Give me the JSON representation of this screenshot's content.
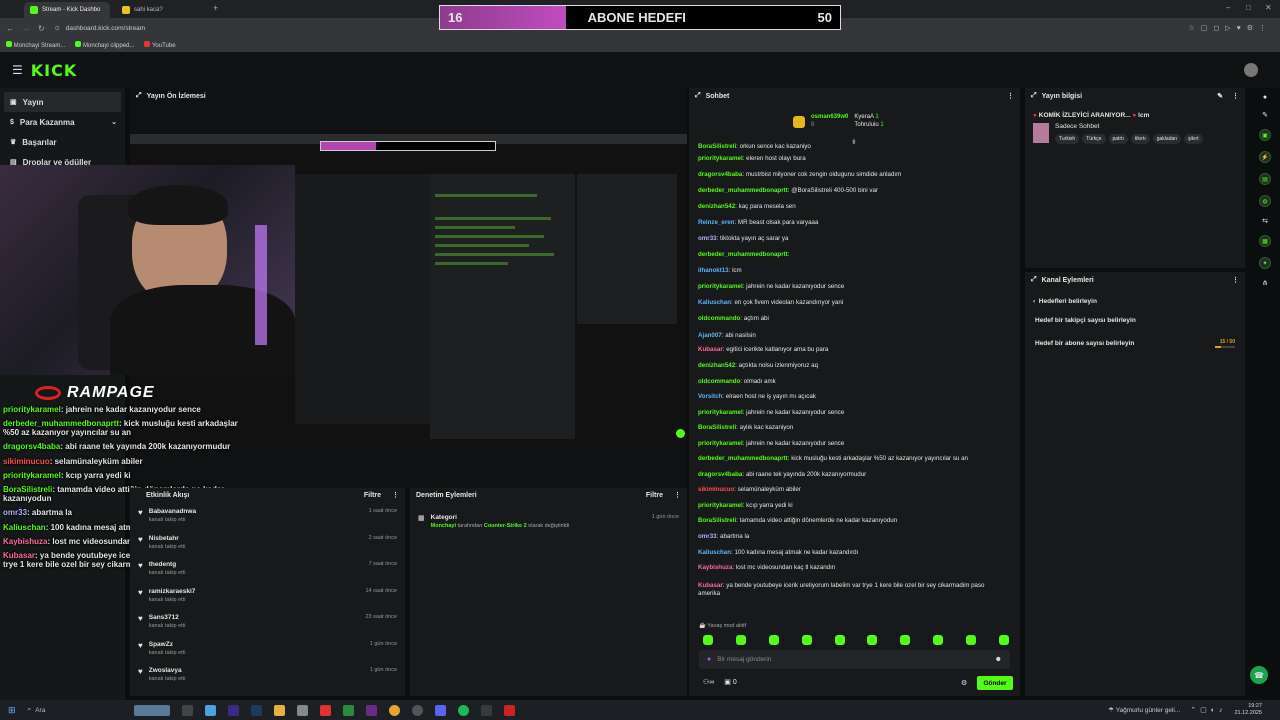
{
  "browser": {
    "tabs": [
      {
        "label": "Stream - Kick Dashbo",
        "active": true
      },
      {
        "label": "sahi kaca?",
        "active": false
      }
    ],
    "url": "dashboard.kick.com/stream",
    "bookmarks": [
      "Monchayi Stream...",
      "Monchayi clipped...",
      "YouTube"
    ]
  },
  "goal_overlay": {
    "current": "16",
    "label": "ABONE HEDEFI",
    "target": "50",
    "progress": 0.32
  },
  "app": {
    "logo": "KICK"
  },
  "sidebar": {
    "items": [
      {
        "label": "Yayın",
        "icon": "broadcast-icon"
      },
      {
        "label": "Para Kazanma",
        "icon": "money-icon"
      },
      {
        "label": "Başarılar",
        "icon": "trophy-icon"
      },
      {
        "label": "Droplar ve ödüller",
        "icon": "gift-icon"
      }
    ]
  },
  "preview": {
    "title": "Yayın Ön İzlemesi"
  },
  "overlay_chat": {
    "brand": "RAMPAGE",
    "lines": [
      {
        "user": "prioritykaramel",
        "color": "#53fc18",
        "text": "jahrein ne kadar kazanıyodur sence"
      },
      {
        "user": "derbeder_muhammedbonaprtt",
        "color": "#53fc18",
        "text": "kick musluğu kesti arkadaşlar %50 az kazanıyor yayıncılar su an"
      },
      {
        "user": "dragorsv4baba",
        "color": "#53fc18",
        "text": "abi raane tek yayında 200k kazanıyormudur"
      },
      {
        "user": "sikiminucuo",
        "color": "#ff4d4d",
        "text": "selamünaleyküm abiler"
      },
      {
        "user": "prioritykaramel",
        "color": "#53fc18",
        "text": "kcıp yarra yedi ki"
      },
      {
        "user": "BoraSilistreli",
        "color": "#53fc18",
        "text": "tamamda video attiğin dönemlerde ne kadar kazanıyodun"
      },
      {
        "user": "omr33",
        "color": "#b0b0ff",
        "text": "abartma la"
      },
      {
        "user": "Kaliuschan",
        "color": "#53fc18",
        "text": "100 kadına mesaj atmak ne kadar kazandırdı"
      },
      {
        "user": "Kaybishuza",
        "color": "#ff6b9d",
        "text": "lost mc videosundan kaç tl kazandın"
      },
      {
        "user": "Kubasar",
        "color": "#ff6b9d",
        "text": "ya bende youtubeye icerik uretiyorum labelim var trye 1 kere bile ozel bir sey cikarmadim paso amerika"
      }
    ]
  },
  "activity": {
    "title": "Etkinlik Akışı",
    "filter_label": "Filtre",
    "items": [
      {
        "name": "Babavanadnwa",
        "sub": "kanalı takip etti",
        "time": "1 saat önce"
      },
      {
        "name": "Nisbetahr",
        "sub": "kanalı takip etti",
        "time": "2 saat önce"
      },
      {
        "name": "thedentg",
        "sub": "kanalı takip etti",
        "time": "7 saat önce"
      },
      {
        "name": "ramizkaraeski7",
        "sub": "kanalı takip etti",
        "time": "14 saat önce"
      },
      {
        "name": "Sans3712",
        "sub": "kanalı takip etti",
        "time": "23 saat önce"
      },
      {
        "name": "SpawZz",
        "sub": "kanalı takip etti",
        "time": "1 gün önce"
      },
      {
        "name": "Zwoslavya",
        "sub": "kanalı takip etti",
        "time": "1 gün önce"
      }
    ]
  },
  "audit": {
    "title": "Denetim Eylemleri",
    "filter_label": "Filtre",
    "item": {
      "title": "Kategori",
      "actor": "Monchayi",
      "middle": "tarafından",
      "category": "Counter-Strike 2",
      "rest": "olarak değiştirildi",
      "time": "1 gün önce"
    }
  },
  "chat": {
    "title": "Sohbet",
    "pinned": {
      "user1": "osman639w0",
      "user1_count": "8",
      "user2": "KyeraA",
      "user2_count": "1",
      "user3": "Tohruluiu",
      "user3_count": "1"
    },
    "messages": [
      {
        "user": "BoraSilistreli",
        "color": "#53fc18",
        "text": "orkun sence kac kazaniyo"
      },
      {
        "user": "prioritykaramel",
        "color": "#53fc18",
        "text": "eleren host olayı bura"
      },
      {
        "user": "dragorsv4baba",
        "color": "#53fc18",
        "text": "mustrbist milyoner cok zengin oldugunu simdide anladım"
      },
      {
        "user": "derbeder_muhammedbonaprtt",
        "color": "#53fc18",
        "text": "@BoraSilistreli 400-500 bini var"
      },
      {
        "user": "denizhan542",
        "color": "#53fc18",
        "text": "kaç para mesela sen"
      },
      {
        "user": "Reinze_eren",
        "color": "#58b8ff",
        "text": "MR beast olsak para varyaaa"
      },
      {
        "user": "omr33",
        "color": "#b0b0ff",
        "text": "tiktokta yayın aç sarar ya"
      },
      {
        "user": "derbeder_muhammedbonaprtt",
        "color": "#53fc18",
        "text": ""
      },
      {
        "user": "ilhanokt13",
        "color": "#58b8ff",
        "text": "lcm"
      },
      {
        "user": "prioritykaramel",
        "color": "#53fc18",
        "text": "jahrein ne kadar kazanıyodur sence"
      },
      {
        "user": "Kaliuschan",
        "color": "#58b8ff",
        "text": "en çok fivem videoları kazandırıyor yani"
      },
      {
        "user": "oldcommando",
        "color": "#53fc18",
        "text": "açtım abi"
      },
      {
        "user": "Ajan007",
        "color": "#58b8ff",
        "text": "abi nasilsin"
      },
      {
        "user": "Kubasar",
        "color": "#ff6b9d",
        "text": "egitici icerikte katlanıyor ama bu para"
      },
      {
        "user": "denizhan542",
        "color": "#53fc18",
        "text": "açtıkta nolsu izlenmiyoruz aq"
      },
      {
        "user": "oldcommando",
        "color": "#53fc18",
        "text": "olmadı amk"
      },
      {
        "user": "Vorsitch",
        "color": "#58b8ff",
        "text": "elraen host ne iş yayın mı açıcak"
      },
      {
        "user": "prioritykaramel",
        "color": "#53fc18",
        "text": "jahrein ne kadar kazanıyodur sence"
      },
      {
        "user": "BoraSilistreli",
        "color": "#53fc18",
        "text": "aylık kac kazaniyon"
      },
      {
        "user": "prioritykaramel",
        "color": "#53fc18",
        "text": "jahrein ne kadar kazanıyodur sence"
      },
      {
        "user": "derbeder_muhammedbonaprtt",
        "color": "#53fc18",
        "text": "kick musluğu kesti arkadaşlar %50 az kazanıyor yayıncılar su an"
      },
      {
        "user": "dragorsv4baba",
        "color": "#53fc18",
        "text": "abi raane tek yayında 200k kazanıyormudur"
      },
      {
        "user": "sikiminucuo",
        "color": "#ff4d4d",
        "text": "selamünaleyküm abiler"
      },
      {
        "user": "prioritykaramel",
        "color": "#53fc18",
        "text": "kcıp yarra yedi ki"
      },
      {
        "user": "BoraSilistreli",
        "color": "#53fc18",
        "text": "tamamda video attiğin dönemlerde ne kadar kazanıyodun"
      },
      {
        "user": "omr33",
        "color": "#b0b0ff",
        "text": "abartma la"
      },
      {
        "user": "Kaliuschan",
        "color": "#58b8ff",
        "text": "100 kadına mesaj atmak ne kadar kazandırdı"
      },
      {
        "user": "Kaybishuza",
        "color": "#ff6b9d",
        "text": "lost mc videosundan kaç tl kazandın"
      },
      {
        "user": "Kubasar",
        "color": "#ff6b9d",
        "text": "ya bende youtubeye icerik uretiyorum labelim var trye 1 kere bile ozel bir sey cikarmadim paso amerika"
      }
    ],
    "slow_mode": "Yavaş mod aktif",
    "input_placeholder": "Bir mesaj gönderin",
    "viewer_count": "0",
    "send_label": "Gönder"
  },
  "stream_info": {
    "title": "Yayın bilgisi",
    "stream_title": "KOMİK İZLEYİCİ ARANIYOR...",
    "stream_title_suffix": "lcm",
    "category": "Sadece Sohbet",
    "tags": [
      "Turkish",
      "Türkçe",
      "patrtı",
      "tikırtı",
      "gakladan",
      "şikırt"
    ]
  },
  "channel_actions": {
    "title": "Kanal Eylemleri",
    "back_label": "Hedefleri belirleyin",
    "follower_goal": "Hedef bir takipçi sayısı belirleyin",
    "sub_goal": "Hedef bir abone sayısı belirleyin",
    "sub_goal_progress": "15 / 50"
  },
  "taskbar": {
    "search": "Ara",
    "weather": "Yağmurlu günler geli...",
    "time": "19:27",
    "date": "21.12.2025"
  },
  "colors": {
    "accent": "#53fc18",
    "bg": "#0b0e0f",
    "panel": "#17191a"
  }
}
